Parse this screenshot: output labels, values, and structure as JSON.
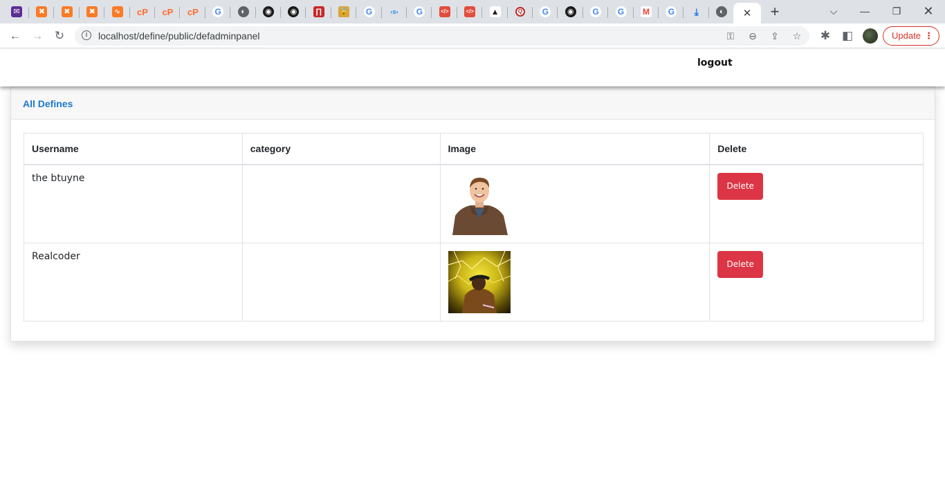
{
  "browser": {
    "url": "localhost/define/public/defadminpanel",
    "active_tab_close": "✕",
    "new_tab": "+",
    "update_label": "Update",
    "tabs": [
      {
        "icon": "mail-icon",
        "glyph": "✉",
        "cls": "mail"
      },
      {
        "icon": "xampp-icon",
        "glyph": "✖",
        "cls": "xampp"
      },
      {
        "icon": "xampp-icon",
        "glyph": "✖",
        "cls": "xampp"
      },
      {
        "icon": "xampp-icon",
        "glyph": "✖",
        "cls": "xampp"
      },
      {
        "icon": "xampp-icon",
        "glyph": "∿",
        "cls": "xampp"
      },
      {
        "icon": "cpanel-icon",
        "glyph": "cP",
        "cls": "cp"
      },
      {
        "icon": "cpanel-icon",
        "glyph": "cP",
        "cls": "cp"
      },
      {
        "icon": "cpanel-icon",
        "glyph": "cP",
        "cls": "cp"
      },
      {
        "icon": "google-icon",
        "glyph": "G",
        "cls": "g"
      },
      {
        "icon": "globe-icon",
        "glyph": "◐",
        "cls": "globe"
      },
      {
        "icon": "github-icon",
        "glyph": "◉",
        "cls": "gh"
      },
      {
        "icon": "github-icon",
        "glyph": "◉",
        "cls": "gh"
      },
      {
        "icon": "notebook-icon",
        "glyph": "∏",
        "cls": "nb"
      },
      {
        "icon": "lock-icon",
        "glyph": "🔒",
        "cls": "lock"
      },
      {
        "icon": "google-icon",
        "glyph": "G",
        "cls": "g"
      },
      {
        "icon": "code-icon",
        "glyph": "‹s›",
        "cls": "code"
      },
      {
        "icon": "google-icon",
        "glyph": "G",
        "cls": "g"
      },
      {
        "icon": "html-code-icon",
        "glyph": "</>",
        "cls": "red"
      },
      {
        "icon": "html-code-icon",
        "glyph": "</>",
        "cls": "red"
      },
      {
        "icon": "linux-icon",
        "glyph": "▲",
        "cls": "tux"
      },
      {
        "icon": "quora-icon",
        "glyph": "Q",
        "cls": "q"
      },
      {
        "icon": "google-icon",
        "glyph": "G",
        "cls": "g"
      },
      {
        "icon": "github-icon",
        "glyph": "◉",
        "cls": "gh"
      },
      {
        "icon": "google-icon",
        "glyph": "G",
        "cls": "g"
      },
      {
        "icon": "google-icon",
        "glyph": "G",
        "cls": "g"
      },
      {
        "icon": "gmail-icon",
        "glyph": "M",
        "cls": "gm"
      },
      {
        "icon": "google-icon",
        "glyph": "G",
        "cls": "g"
      },
      {
        "icon": "download-icon",
        "glyph": "⤓",
        "cls": "dl"
      },
      {
        "icon": "globe-icon",
        "glyph": "◐",
        "cls": "globe"
      }
    ]
  },
  "navbar": {
    "logout_label": "logout"
  },
  "card": {
    "title": "All Defines"
  },
  "table": {
    "headers": [
      "Username",
      "category",
      "Image",
      "Delete"
    ],
    "rows": [
      {
        "username": "the btuyne",
        "category": "",
        "image": "person-photo",
        "delete_label": "Delete"
      },
      {
        "username": "Realcoder",
        "category": "",
        "image": "person-photo-yellow",
        "delete_label": "Delete"
      }
    ]
  },
  "colors": {
    "accent": "#1b78d0",
    "danger": "#dc3545",
    "update": "#d93025"
  }
}
